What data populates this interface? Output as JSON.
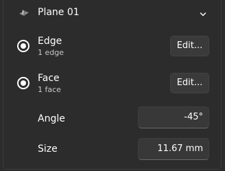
{
  "header": {
    "title": "Plane 01",
    "icon": "plane-icon",
    "expand_icon": "chevron-down-icon"
  },
  "selections": [
    {
      "label": "Edge",
      "sub": "1 edge",
      "button": "Edit...",
      "selected": true
    },
    {
      "label": "Face",
      "sub": "1 face",
      "button": "Edit...",
      "selected": true
    }
  ],
  "fields": {
    "angle": {
      "label": "Angle",
      "value": "-45°"
    },
    "size": {
      "label": "Size",
      "value": "11.67 mm"
    }
  }
}
